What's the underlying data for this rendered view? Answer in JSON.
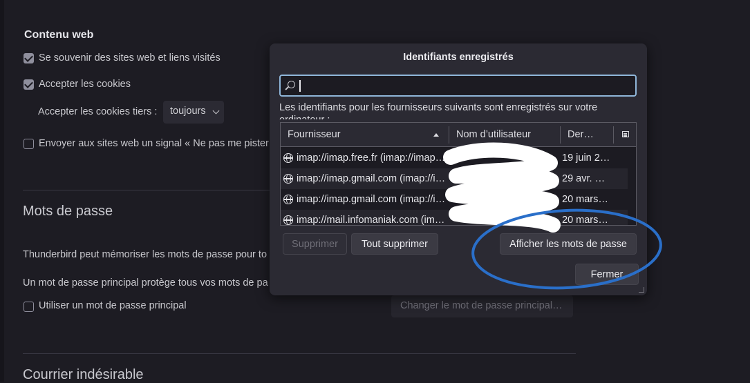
{
  "settings": {
    "web_content_title": "Contenu web",
    "remember_sites_label": "Se souvenir des sites web et liens visités",
    "accept_cookies_label": "Accepter les cookies",
    "third_party_label": "Accepter les cookies tiers :",
    "third_party_value": "toujours",
    "dnt_label": "Envoyer aux sites web un signal « Ne pas me pister",
    "passwords_title": "Mots de passe",
    "passwords_desc": "Thunderbird peut mémoriser les mots de passe pour to",
    "primary_desc": "Un mot de passe principal protège tous vos mots de pa",
    "use_primary_label": "Utiliser un mot de passe principal",
    "change_primary_label": "Changer le mot de passe principal…",
    "junk_title": "Courrier indésirable"
  },
  "dialog": {
    "title": "Identifiants enregistrés",
    "search_value": "",
    "info_text": "Les identifiants pour les fournisseurs suivants sont enregistrés sur votre ordinateur :",
    "columns": {
      "provider": "Fournisseur",
      "username": "Nom d’utilisateur",
      "date": "Der…"
    },
    "rows": [
      {
        "provider": "imap://imap.free.fr (imap://imap.free.fr)",
        "username": "",
        "date": "19 juin 2…"
      },
      {
        "provider": "imap://imap.gmail.com (imap://imap.gmail.com)",
        "username": "",
        "date": "29 avr. 2…"
      },
      {
        "provider": "imap://imap.gmail.com (imap://imap.gmail.com)",
        "username": "",
        "date": "20 mars …"
      },
      {
        "provider": "imap://mail.infomaniak.com (imap://mail.infomaniak.com)",
        "username": "",
        "date": "20 mars …"
      }
    ],
    "buttons": {
      "remove": "Supprimer",
      "remove_all": "Tout supprimer",
      "show_passwords": "Afficher les mots de passe",
      "close": "Fermer"
    }
  },
  "colors": {
    "page_bg": "#1d1c23",
    "dialog_bg": "#2b2a33",
    "focus_ring": "#8fb6d9",
    "annotation_blue": "#2a6fc9",
    "scribble": "#ffffff"
  }
}
